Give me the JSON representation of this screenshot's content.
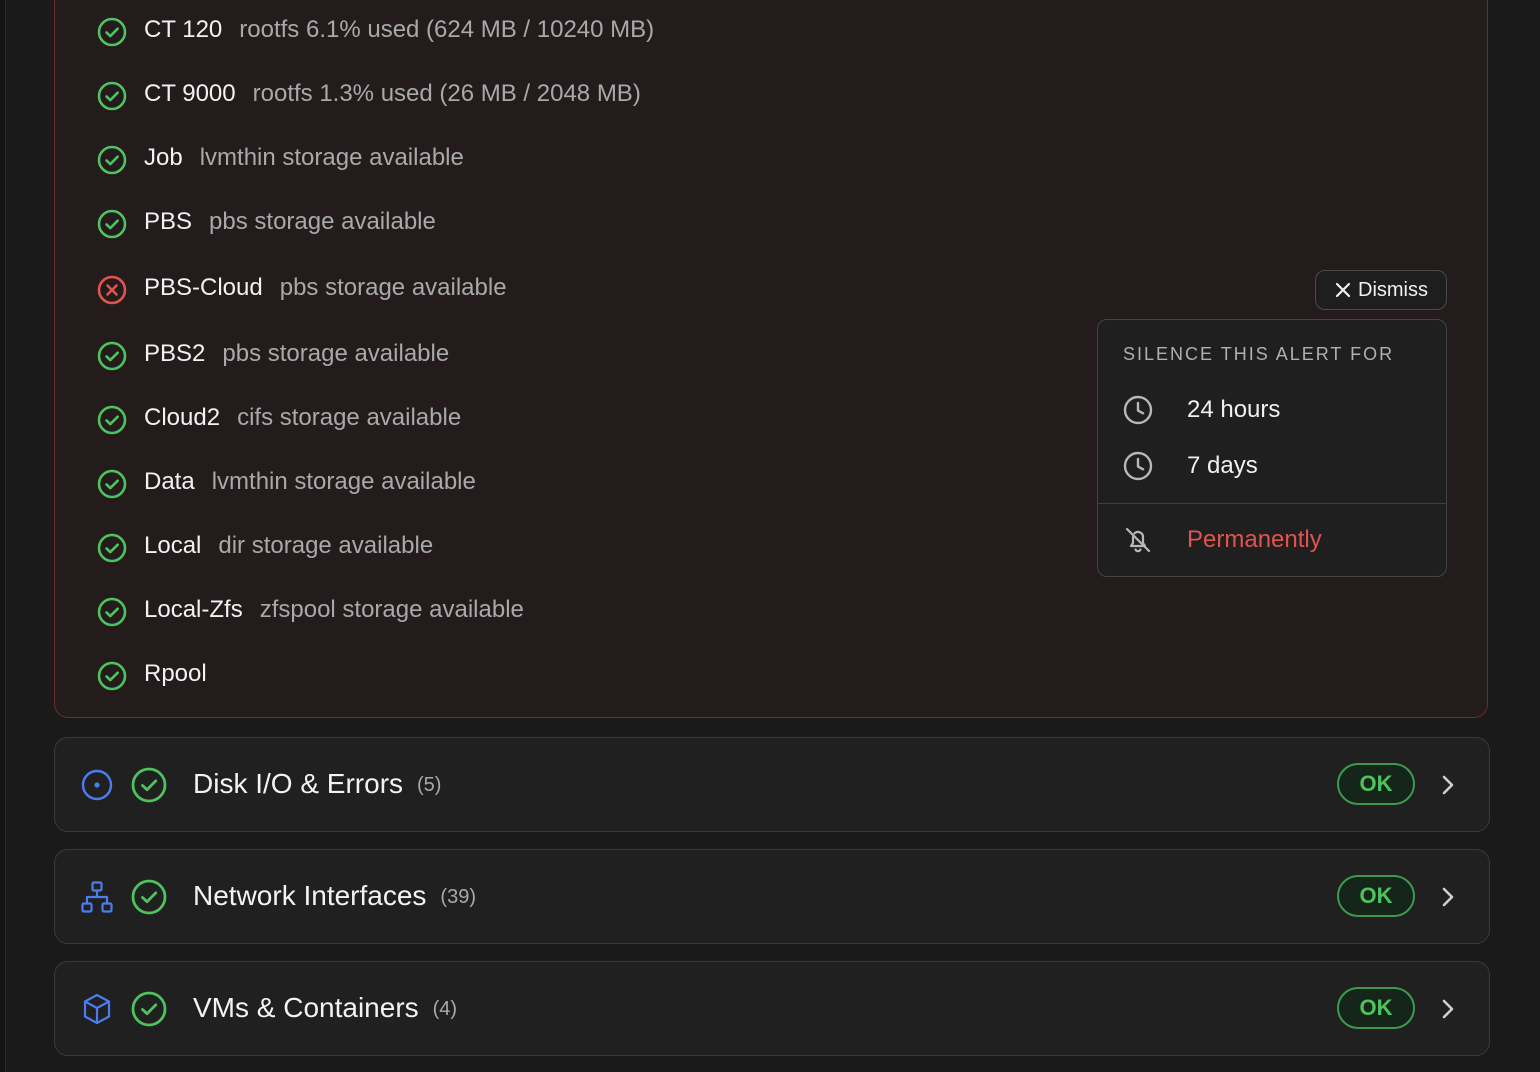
{
  "storage": {
    "rows": [
      {
        "name": "CT 120",
        "detail": "rootfs 6.1% used (624 MB / 10240 MB)",
        "status": "ok"
      },
      {
        "name": "CT 9000",
        "detail": "rootfs 1.3% used (26 MB / 2048 MB)",
        "status": "ok"
      },
      {
        "name": "Job",
        "detail": "lvmthin storage available",
        "status": "ok"
      },
      {
        "name": "PBS",
        "detail": "pbs storage available",
        "status": "ok"
      },
      {
        "name": "PBS-Cloud",
        "detail": "pbs storage available",
        "status": "error"
      },
      {
        "name": "PBS2",
        "detail": "pbs storage available",
        "status": "ok"
      },
      {
        "name": "Cloud2",
        "detail": "cifs storage available",
        "status": "ok"
      },
      {
        "name": "Data",
        "detail": "lvmthin storage available",
        "status": "ok"
      },
      {
        "name": "Local",
        "detail": "dir storage available",
        "status": "ok"
      },
      {
        "name": "Local-Zfs",
        "detail": "zfspool storage available",
        "status": "ok"
      },
      {
        "name": "Rpool",
        "detail": "",
        "status": "ok"
      }
    ]
  },
  "dismiss": {
    "label": "Dismiss"
  },
  "silence_menu": {
    "heading": "SILENCE THIS ALERT FOR",
    "option_24h": "24 hours",
    "option_7d": "7 days",
    "option_permanent": "Permanently"
  },
  "sections": [
    {
      "title": "Disk I/O & Errors",
      "count": "(5)",
      "badge": "OK",
      "icon": "disk-icon"
    },
    {
      "title": "Network Interfaces",
      "count": "(39)",
      "badge": "OK",
      "icon": "network-icon"
    },
    {
      "title": "VMs & Containers",
      "count": "(4)",
      "badge": "OK",
      "icon": "cube-icon"
    }
  ],
  "colors": {
    "ok_green": "#4fc25f",
    "error_red": "#e0544f",
    "accent_blue": "#4c7cf0",
    "panel_bg": "#241b1c",
    "panel_border": "#6b2e2e"
  }
}
